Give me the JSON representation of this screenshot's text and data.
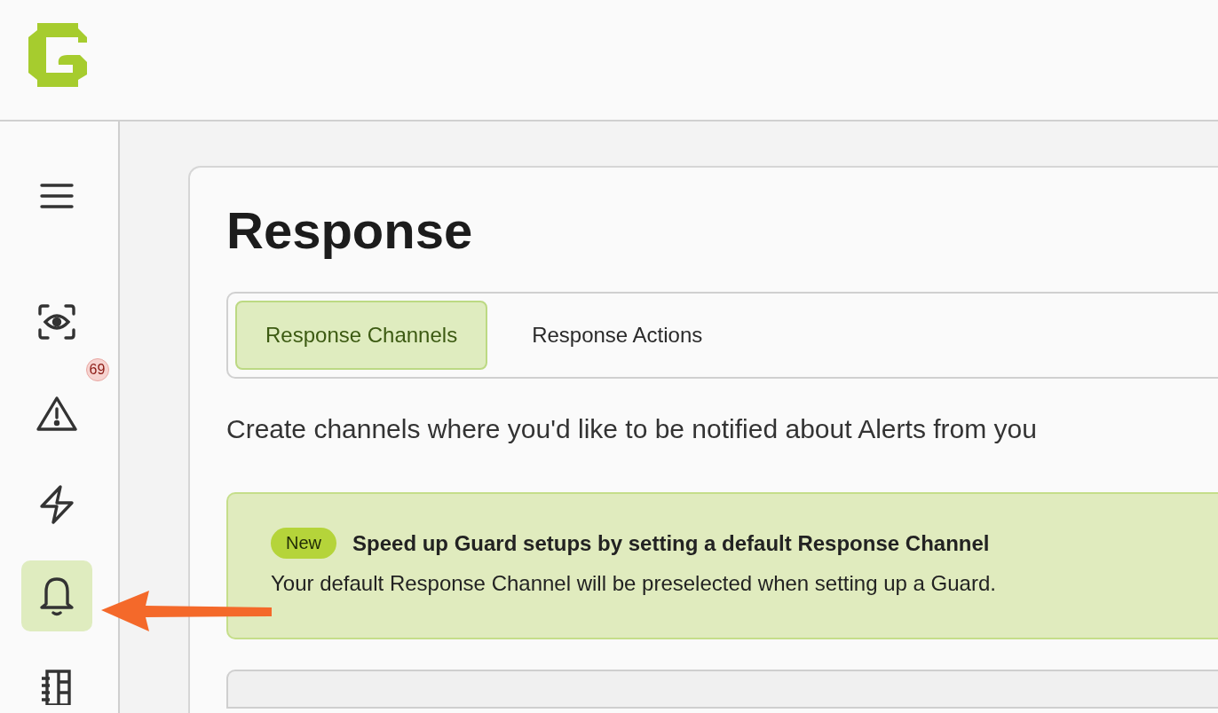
{
  "sidebar": {
    "items": [
      {
        "kind": "eye",
        "selected": false
      },
      {
        "kind": "alert",
        "selected": false,
        "badge": "69"
      },
      {
        "kind": "bolt",
        "selected": false
      },
      {
        "kind": "bell",
        "selected": true
      },
      {
        "kind": "notebook",
        "selected": false
      }
    ]
  },
  "page": {
    "title": "Response",
    "tabs": [
      {
        "label": "Response Channels",
        "selected": true
      },
      {
        "label": "Response Actions",
        "selected": false
      }
    ],
    "description": "Create channels where you'd like to be notified about Alerts from you",
    "banner": {
      "badge": "New",
      "title": "Speed up Guard setups by setting a default Response Channel",
      "text": "Your default Response Channel will be preselected when setting up a Guard."
    }
  }
}
